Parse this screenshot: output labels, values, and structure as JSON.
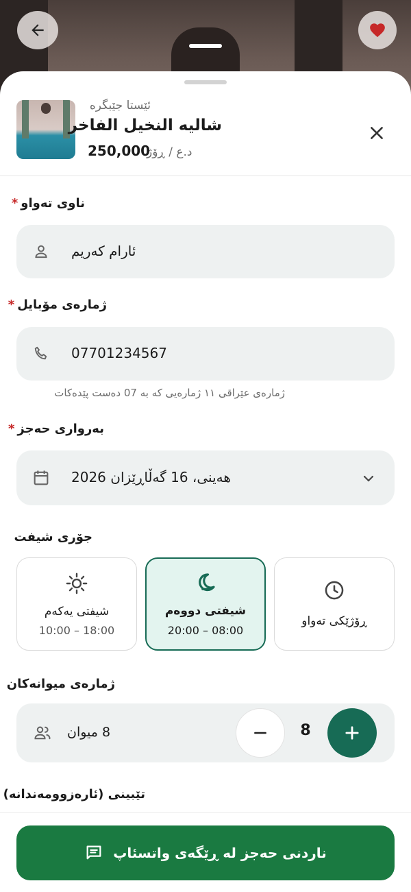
{
  "hero": {
    "back_icon": "arrow-left-icon",
    "favorite_icon": "heart-icon",
    "favorite_color": "#c62828"
  },
  "summary": {
    "kicker": "ئێستا جێبگرە",
    "title": "شاليه النخيل الفاخر",
    "price": "250,000",
    "unit": "د.ع / ڕۆژ",
    "close_icon": "close-icon"
  },
  "form": {
    "name": {
      "label": "ناوی تەواو",
      "required": "*",
      "value": "ئارام کەریم",
      "icon": "person-icon"
    },
    "phone": {
      "label": "ژمارەی مۆبایل",
      "required": "*",
      "value": "07701234567",
      "icon": "phone-icon",
      "hint": "ژمارەی عێراقی ١١ ژمارەیی کە بە 07 دەست پێدەکات"
    },
    "date": {
      "label": "بەرواری حەجز",
      "required": "*",
      "value": "هەینی، 16 گەڵاڕێزان 2026",
      "icon": "calendar-icon",
      "dropdown_icon": "chevron-down-icon"
    },
    "shift": {
      "label": "جۆری شیفت",
      "options": [
        {
          "name": "شیفتی یەکەم",
          "time": "10:00 – 18:00",
          "icon": "sun-icon",
          "selected": false
        },
        {
          "name": "شیفتی دووەم",
          "time": "20:00 – 08:00",
          "icon": "moon-icon",
          "selected": true
        },
        {
          "name": "ڕۆژێکی تەواو",
          "time": "",
          "icon": "clock-icon",
          "selected": false
        }
      ]
    },
    "guests": {
      "label": "ژمارەی میوانەکان",
      "text": "8 میوان",
      "count": "8",
      "icon": "people-icon",
      "minus_icon": "minus-icon",
      "plus_icon": "plus-icon"
    },
    "notes": {
      "label": "تێبینی (ئارەزوومەندانە)"
    }
  },
  "submit": {
    "label": "ناردنی حەجز لە ڕێگەی واتسئاپ",
    "icon": "message-icon"
  },
  "colors": {
    "accent": "#176b55",
    "whatsapp": "#1a7a41",
    "required": "#c62828",
    "field_bg": "#eef1f1",
    "selected_bg": "#e3f4ef"
  }
}
